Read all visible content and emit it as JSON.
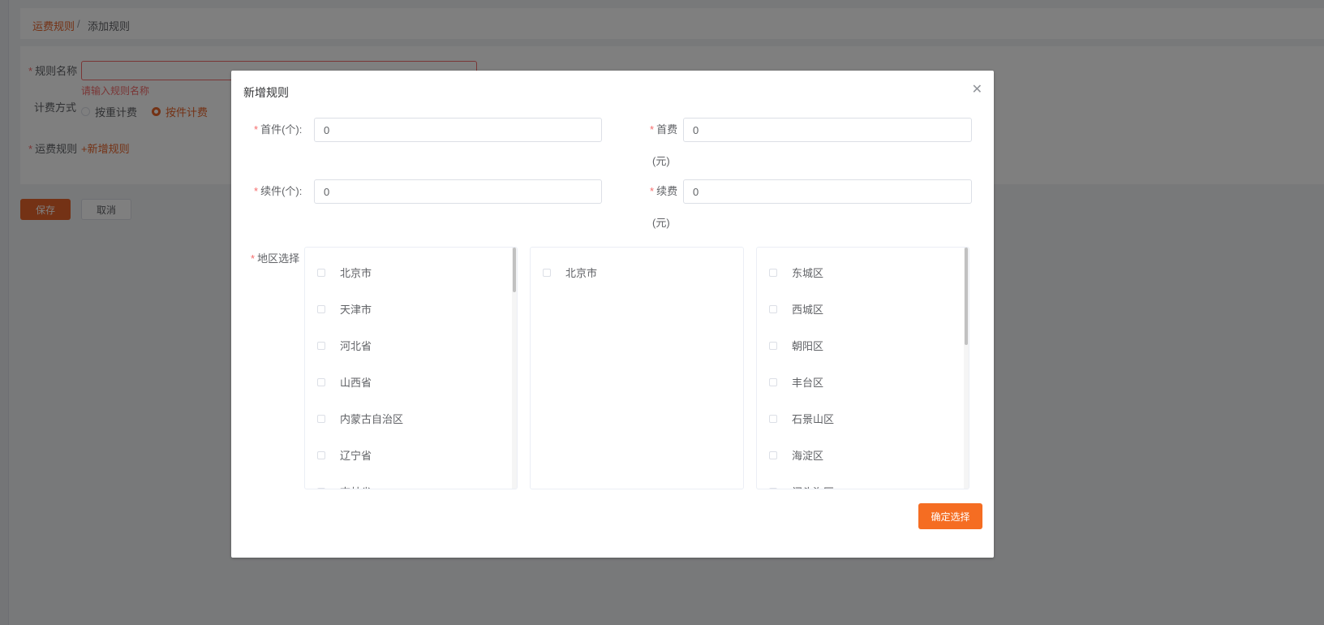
{
  "breadcrumb": {
    "parent": "运费规则",
    "separator": "/",
    "current": "添加规则"
  },
  "form": {
    "rule_name_label": "规则名称",
    "rule_name_error": "请输入规则名称",
    "billing_label": "计费方式",
    "billing_options": [
      "按重计费",
      "按件计费"
    ],
    "billing_selected": "按件计费",
    "shipping_rules_label": "运费规则",
    "add_rule_link": "+新增规则",
    "save_label": "保存",
    "cancel_label": "取消"
  },
  "dialog": {
    "title": "新增规则",
    "close_icon": "close-icon",
    "first_count_label": "首件(个):",
    "first_count_value": "0",
    "first_fee_label": "首费",
    "first_fee_unit": "(元)",
    "first_fee_value": "0",
    "extra_count_label": "续件(个):",
    "extra_count_value": "0",
    "extra_fee_label": "续费",
    "extra_fee_unit": "(元)",
    "extra_fee_value": "0",
    "region_label": "地区选择",
    "provinces": [
      "北京市",
      "天津市",
      "河北省",
      "山西省",
      "内蒙古自治区",
      "辽宁省",
      "吉林省"
    ],
    "cities": [
      "北京市"
    ],
    "districts": [
      "东城区",
      "西城区",
      "朝阳区",
      "丰台区",
      "石景山区",
      "海淀区",
      "门头沟区"
    ],
    "confirm_label": "确定选择"
  },
  "colors": {
    "accent": "#e8642a",
    "confirm": "#f56d22",
    "error": "#f56c6c"
  }
}
